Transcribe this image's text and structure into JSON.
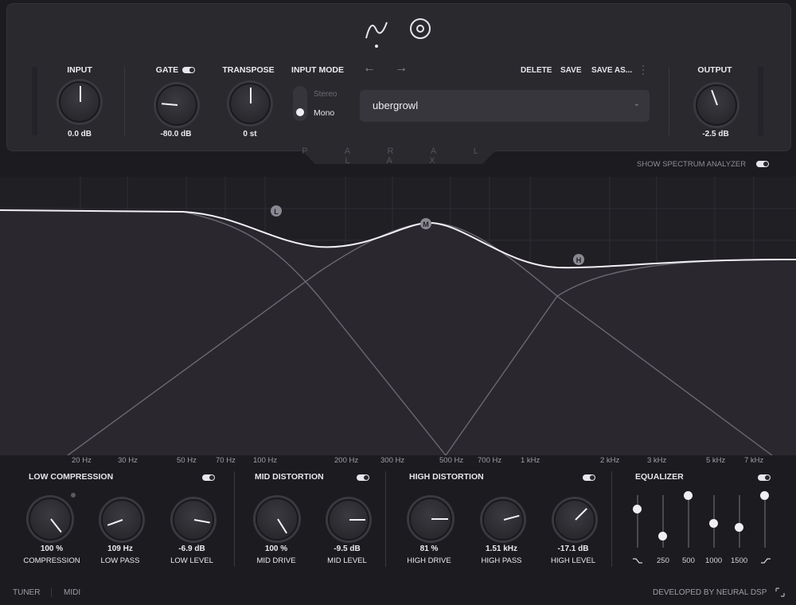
{
  "header": {
    "brand": "P A R A L L A X",
    "input": {
      "label": "INPUT",
      "value": "0.0 dB"
    },
    "gate": {
      "label": "GATE",
      "value": "-80.0 dB"
    },
    "transpose": {
      "label": "TRANSPOSE",
      "value": "0 st"
    },
    "input_mode": {
      "label": "INPUT MODE",
      "options": [
        "Stereo",
        "Mono"
      ],
      "selected": "Mono"
    },
    "preset": {
      "name": "ubergrowl"
    },
    "actions": {
      "delete": "DELETE",
      "save": "SAVE",
      "save_as": "SAVE AS..."
    },
    "output": {
      "label": "OUTPUT",
      "value": "-2.5 dB"
    }
  },
  "spectrum_toggle": "SHOW SPECTRUM ANALYZER",
  "graph": {
    "nodes": [
      "L",
      "M",
      "H"
    ],
    "freq_labels": [
      "20 Hz",
      "30 Hz",
      "50 Hz",
      "70 Hz",
      "100 Hz",
      "200 Hz",
      "300 Hz",
      "500 Hz",
      "700 Hz",
      "1 kHz",
      "2 kHz",
      "3 kHz",
      "5 kHz",
      "7 kHz"
    ]
  },
  "low": {
    "title": "LOW COMPRESSION",
    "knobs": [
      {
        "value": "100 %",
        "label": "COMPRESSION"
      },
      {
        "value": "109 Hz",
        "label": "LOW PASS"
      },
      {
        "value": "-6.9 dB",
        "label": "LOW LEVEL"
      }
    ]
  },
  "mid": {
    "title": "MID DISTORTION",
    "knobs": [
      {
        "value": "100 %",
        "label": "MID DRIVE"
      },
      {
        "value": "-9.5 dB",
        "label": "MID LEVEL"
      }
    ]
  },
  "high": {
    "title": "HIGH DISTORTION",
    "knobs": [
      {
        "value": "81 %",
        "label": "HIGH DRIVE"
      },
      {
        "value": "1.51 kHz",
        "label": "HIGH PASS"
      },
      {
        "value": "-17.1 dB",
        "label": "HIGH LEVEL"
      }
    ]
  },
  "eq": {
    "title": "EQUALIZER",
    "bands": [
      "250",
      "500",
      "1000",
      "1500"
    ]
  },
  "footer": {
    "tuner": "TUNER",
    "midi": "MIDI",
    "dev": "DEVELOPED BY NEURAL DSP"
  },
  "colors": {
    "bg": "#1c1b1f",
    "panel": "#2a292e",
    "curve": "#f2f0f5"
  }
}
